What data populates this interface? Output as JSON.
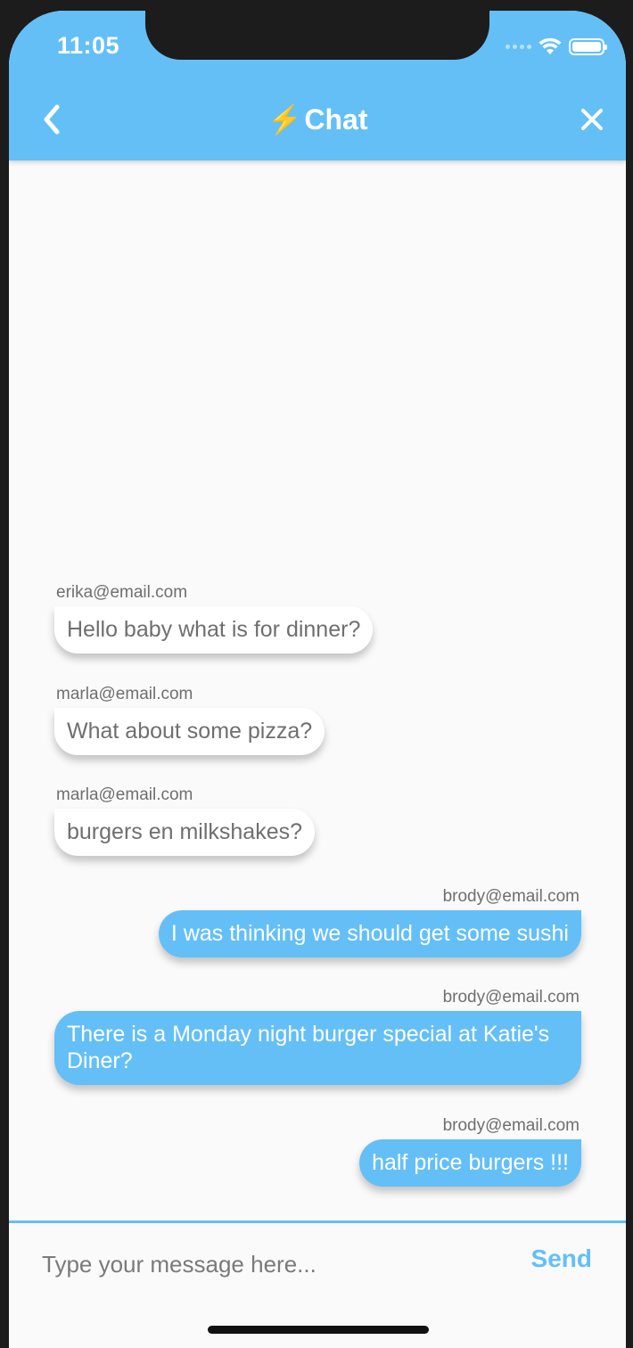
{
  "status_bar": {
    "time": "11:05"
  },
  "nav": {
    "title_icon": "⚡",
    "title": "Chat"
  },
  "messages": [
    {
      "sender": "erika@email.com",
      "text": "Hello baby what is for dinner?",
      "side": "left"
    },
    {
      "sender": "marla@email.com",
      "text": "What about some pizza?",
      "side": "left"
    },
    {
      "sender": "marla@email.com",
      "text": "burgers en milkshakes?",
      "side": "left"
    },
    {
      "sender": "brody@email.com",
      "text": "I was thinking we should get some sushi",
      "side": "right"
    },
    {
      "sender": "brody@email.com",
      "text": "There is a Monday night burger special at Katie's Diner?",
      "side": "right"
    },
    {
      "sender": "brody@email.com",
      "text": "half price burgers !!!",
      "side": "right"
    }
  ],
  "composer": {
    "placeholder": "Type your message here...",
    "send_label": "Send"
  },
  "colors": {
    "accent": "#64bff7",
    "background": "#fafafa",
    "bubble_received": "#ffffff"
  },
  "icons": {
    "back": "chevron-left-icon",
    "close": "close-icon",
    "wifi": "wifi-icon",
    "battery": "battery-icon",
    "bolt": "lightning-bolt-icon"
  }
}
